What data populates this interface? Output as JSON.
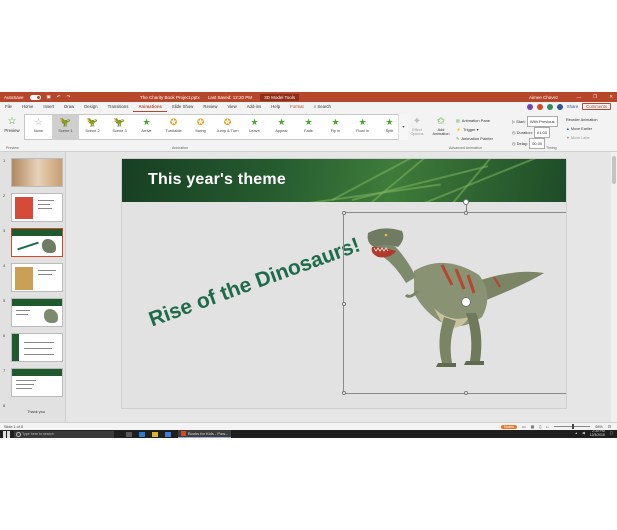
{
  "titlebar": {
    "autosave_label": "AutoSave",
    "autosave_state": "On",
    "document_title": "The Charity Book Project.pptx",
    "last_saved": "Last Saved: 12:20 PM",
    "contextual_tab": "3D Model Tools",
    "user_name": "Aimee Chavez",
    "window_buttons": [
      "—",
      "❐",
      "✕"
    ]
  },
  "menu": {
    "tabs": [
      "File",
      "Home",
      "Insert",
      "Draw",
      "Design",
      "Transitions",
      "Animations",
      "Slide Show",
      "Review",
      "View",
      "Add-ins",
      "Help",
      "Format"
    ],
    "active_tab": "Animations",
    "search": "Search",
    "share": "Share",
    "comments": "Comments"
  },
  "ribbon": {
    "preview": "Preview",
    "animations": [
      {
        "label": "None",
        "glyph": "☆",
        "tone": "gray"
      },
      {
        "label": "Scene 1",
        "glyph": "🦖",
        "tone": "gray"
      },
      {
        "label": "Scene 2",
        "glyph": "🦖",
        "tone": "gray"
      },
      {
        "label": "Scene 3",
        "glyph": "🦖",
        "tone": "gray"
      },
      {
        "label": "Arrive",
        "glyph": "★",
        "tone": "green"
      },
      {
        "label": "Turntable",
        "glyph": "✪",
        "tone": "gold"
      },
      {
        "label": "Swing",
        "glyph": "✪",
        "tone": "gold"
      },
      {
        "label": "Jump & Turn",
        "glyph": "✪",
        "tone": "gold"
      },
      {
        "label": "Leave",
        "glyph": "★",
        "tone": "green"
      },
      {
        "label": "Appear",
        "glyph": "★",
        "tone": "green"
      },
      {
        "label": "Fade",
        "glyph": "★",
        "tone": "green"
      },
      {
        "label": "Fly In",
        "glyph": "★",
        "tone": "green"
      },
      {
        "label": "Float In",
        "glyph": "★",
        "tone": "green"
      },
      {
        "label": "Split",
        "glyph": "★",
        "tone": "green"
      }
    ],
    "effect_options": "Effect Options",
    "add_animation": "Add Animation",
    "advanced": {
      "pane": "Animation Pane",
      "trigger": "Trigger",
      "painter": "Animation Painter"
    },
    "timing": {
      "start_label": "Start:",
      "start_value": "With Previous",
      "duration_label": "Duration:",
      "duration_value": "01.00",
      "delay_label": "Delay:",
      "delay_value": "00.00"
    },
    "reorder": {
      "title": "Reorder Animation",
      "earlier": "Move Earlier",
      "later": "Move Later"
    },
    "group_labels": {
      "preview": "Preview",
      "animation": "Animation",
      "advanced": "Advanced Animation",
      "timing": "Timing"
    }
  },
  "slides": {
    "numbers": [
      "1",
      "2",
      "3",
      "4",
      "5",
      "6",
      "7",
      "8"
    ],
    "active": 3,
    "partial_label": "Thank you"
  },
  "slide": {
    "title": "This year's theme",
    "subtitle": "Rise of the Dinosaurs!"
  },
  "status": {
    "slide_count": "Slide 1 of 8",
    "notes": "Notes",
    "zoom": "98%"
  },
  "taskbar": {
    "search_placeholder": "Type here to search",
    "active_app": "Books for Kids - Pow...",
    "time": "2:30 PM",
    "date": "12/3/2018"
  },
  "colors": {
    "accent": "#b7472a",
    "title_green": "#1e6b4a",
    "anim_green": "#4aa72e"
  }
}
